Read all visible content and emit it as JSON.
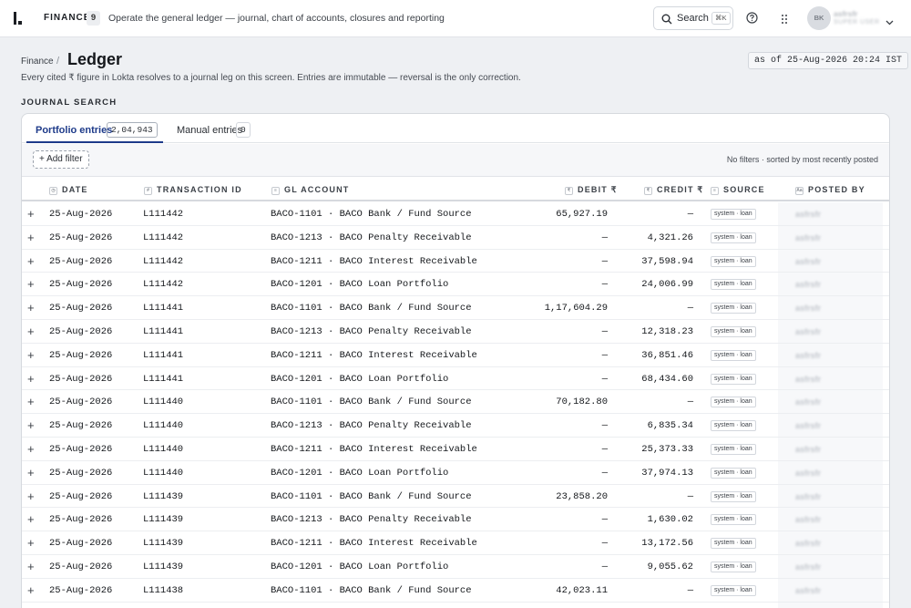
{
  "topbar": {
    "brand": "FINANCE",
    "brand_count": "9",
    "tagline": "Operate the general ledger — journal, chart of accounts, closures and reporting",
    "search_label": "Search",
    "search_shortcut": "⌘K",
    "avatar_initials": "BK",
    "user_name": "asfrsfr",
    "user_role": "SUPER USER"
  },
  "header": {
    "breadcrumb": "Finance",
    "breadcrumb_sep": "/",
    "title": "Ledger",
    "as_of": "as of 25-Aug-2026 20:24 IST",
    "subtitle": "Every cited ₹ figure in Lokta resolves to a journal leg on this screen. Entries are immutable — reversal is the only correction.",
    "section_label": "JOURNAL SEARCH"
  },
  "tabs": [
    {
      "label": "Portfolio entries",
      "count": "2,04,943",
      "active": true
    },
    {
      "label": "Manual entries",
      "count": "0",
      "active": false
    }
  ],
  "filterbar": {
    "add_filter": "+ Add filter",
    "status": "No filters · sorted by most recently posted"
  },
  "columns": {
    "date": {
      "icon": "◷",
      "label": "DATE"
    },
    "tx": {
      "icon": "#",
      "label": "TRANSACTION ID"
    },
    "gl": {
      "icon": "≡",
      "label": "GL ACCOUNT"
    },
    "debit": {
      "icon": "₹",
      "label": "DEBIT ₹"
    },
    "credit": {
      "icon": "₹",
      "label": "CREDIT ₹"
    },
    "source": {
      "icon": "≡",
      "label": "SOURCE"
    },
    "posted": {
      "icon": "Aa",
      "label": "POSTED BY"
    }
  },
  "rows": [
    {
      "date": "25-Aug-2026",
      "tx": "L111442",
      "gl": "BACO-1101 · BACO Bank / Fund Source",
      "debit": "65,927.19",
      "credit": "—",
      "source": "system · loan",
      "posted_by": "asfrsfr"
    },
    {
      "date": "25-Aug-2026",
      "tx": "L111442",
      "gl": "BACO-1213 · BACO Penalty Receivable",
      "debit": "—",
      "credit": "4,321.26",
      "source": "system · loan",
      "posted_by": "asfrsfr"
    },
    {
      "date": "25-Aug-2026",
      "tx": "L111442",
      "gl": "BACO-1211 · BACO Interest Receivable",
      "debit": "—",
      "credit": "37,598.94",
      "source": "system · loan",
      "posted_by": "asfrsfr"
    },
    {
      "date": "25-Aug-2026",
      "tx": "L111442",
      "gl": "BACO-1201 · BACO Loan Portfolio",
      "debit": "—",
      "credit": "24,006.99",
      "source": "system · loan",
      "posted_by": "asfrsfr"
    },
    {
      "date": "25-Aug-2026",
      "tx": "L111441",
      "gl": "BACO-1101 · BACO Bank / Fund Source",
      "debit": "1,17,604.29",
      "credit": "—",
      "source": "system · loan",
      "posted_by": "asfrsfr"
    },
    {
      "date": "25-Aug-2026",
      "tx": "L111441",
      "gl": "BACO-1213 · BACO Penalty Receivable",
      "debit": "—",
      "credit": "12,318.23",
      "source": "system · loan",
      "posted_by": "asfrsfr"
    },
    {
      "date": "25-Aug-2026",
      "tx": "L111441",
      "gl": "BACO-1211 · BACO Interest Receivable",
      "debit": "—",
      "credit": "36,851.46",
      "source": "system · loan",
      "posted_by": "asfrsfr"
    },
    {
      "date": "25-Aug-2026",
      "tx": "L111441",
      "gl": "BACO-1201 · BACO Loan Portfolio",
      "debit": "—",
      "credit": "68,434.60",
      "source": "system · loan",
      "posted_by": "asfrsfr"
    },
    {
      "date": "25-Aug-2026",
      "tx": "L111440",
      "gl": "BACO-1101 · BACO Bank / Fund Source",
      "debit": "70,182.80",
      "credit": "—",
      "source": "system · loan",
      "posted_by": "asfrsfr"
    },
    {
      "date": "25-Aug-2026",
      "tx": "L111440",
      "gl": "BACO-1213 · BACO Penalty Receivable",
      "debit": "—",
      "credit": "6,835.34",
      "source": "system · loan",
      "posted_by": "asfrsfr"
    },
    {
      "date": "25-Aug-2026",
      "tx": "L111440",
      "gl": "BACO-1211 · BACO Interest Receivable",
      "debit": "—",
      "credit": "25,373.33",
      "source": "system · loan",
      "posted_by": "asfrsfr"
    },
    {
      "date": "25-Aug-2026",
      "tx": "L111440",
      "gl": "BACO-1201 · BACO Loan Portfolio",
      "debit": "—",
      "credit": "37,974.13",
      "source": "system · loan",
      "posted_by": "asfrsfr"
    },
    {
      "date": "25-Aug-2026",
      "tx": "L111439",
      "gl": "BACO-1101 · BACO Bank / Fund Source",
      "debit": "23,858.20",
      "credit": "—",
      "source": "system · loan",
      "posted_by": "asfrsfr"
    },
    {
      "date": "25-Aug-2026",
      "tx": "L111439",
      "gl": "BACO-1213 · BACO Penalty Receivable",
      "debit": "—",
      "credit": "1,630.02",
      "source": "system · loan",
      "posted_by": "asfrsfr"
    },
    {
      "date": "25-Aug-2026",
      "tx": "L111439",
      "gl": "BACO-1211 · BACO Interest Receivable",
      "debit": "—",
      "credit": "13,172.56",
      "source": "system · loan",
      "posted_by": "asfrsfr"
    },
    {
      "date": "25-Aug-2026",
      "tx": "L111439",
      "gl": "BACO-1201 · BACO Loan Portfolio",
      "debit": "—",
      "credit": "9,055.62",
      "source": "system · loan",
      "posted_by": "asfrsfr"
    },
    {
      "date": "25-Aug-2026",
      "tx": "L111438",
      "gl": "BACO-1101 · BACO Bank / Fund Source",
      "debit": "42,023.11",
      "credit": "—",
      "source": "system · loan",
      "posted_by": "asfrsfr"
    }
  ],
  "row_expand_glyph": "+"
}
